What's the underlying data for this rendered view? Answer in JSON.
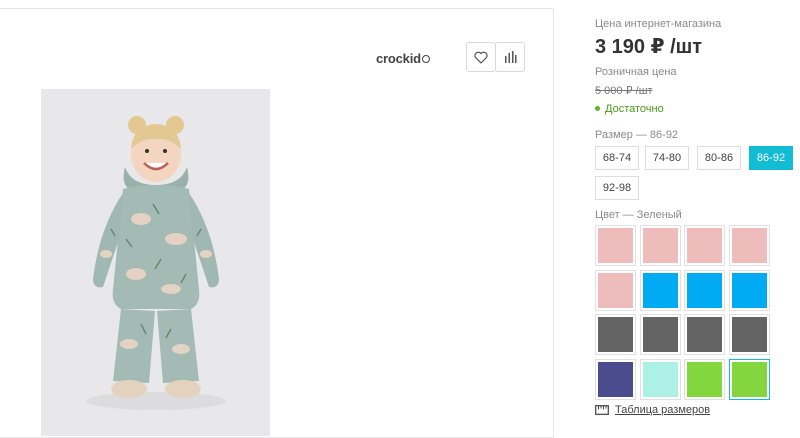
{
  "product": {
    "brand": "crockid",
    "wishlist_icon": "heart-icon",
    "compare_icon": "bar-chart-icon"
  },
  "price": {
    "online_label": "Цена интернет-магазина",
    "online_value": "3 190 ₽ /шт",
    "retail_label": "Розничная цена",
    "retail_value": "5 000 ₽ /шт",
    "stock_status": "Достаточно"
  },
  "size": {
    "label": "Размер — 86-92",
    "options": [
      "68-74",
      "74-80",
      "80-86",
      "86-92",
      "92-98"
    ],
    "selected": "86-92"
  },
  "color": {
    "label": "Цвет — Зеленый",
    "swatches": [
      "#efbcbc",
      "#efbcbc",
      "#efbcbc",
      "#efbcbc",
      "#efbcbc",
      "#00abf3",
      "#00abf3",
      "#00abf3",
      "#646464",
      "#646464",
      "#646464",
      "#646464",
      "#4a4c8e",
      "#acf0e6",
      "#84d63e",
      "#84d63e"
    ],
    "selected_index": 15
  },
  "size_table_link": "Таблица размеров",
  "colors": {
    "accent": "#12bcd4",
    "stock_green": "#4a9a1a"
  }
}
